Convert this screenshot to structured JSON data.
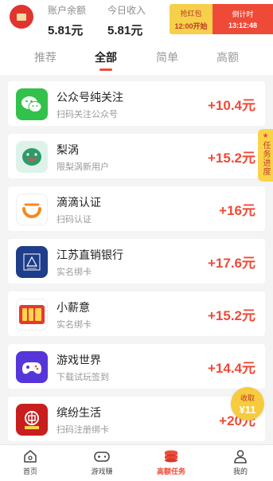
{
  "header": {
    "balance_label": "账户余额",
    "balance_value": "5.81元",
    "today_label": "今日收入",
    "today_value": "5.81元",
    "promo": {
      "grab_label": "抢红包",
      "start_time": "12:00开始",
      "countdown_label": "倒计时",
      "countdown_value": "13:12:48"
    }
  },
  "tabs": [
    {
      "label": "推荐",
      "active": false
    },
    {
      "label": "全部",
      "active": true
    },
    {
      "label": "简单",
      "active": false
    },
    {
      "label": "高额",
      "active": false
    }
  ],
  "tasks": [
    {
      "title": "公众号纯关注",
      "subtitle": "扫码关注公众号",
      "amount": "+10.4元",
      "icon": "wechat-icon"
    },
    {
      "title": "梨涡",
      "subtitle": "限梨涡新用户",
      "amount": "+15.2元",
      "icon": "lianwo-icon"
    },
    {
      "title": "滴滴认证",
      "subtitle": "扫码认证",
      "amount": "+16元",
      "icon": "didi-icon"
    },
    {
      "title": "江苏直销银行",
      "subtitle": "实名绑卡",
      "amount": "+17.6元",
      "icon": "jiangsu-bank-icon"
    },
    {
      "title": "小薪意",
      "subtitle": "实名绑卡",
      "amount": "+15.2元",
      "icon": "xiaoxinyi-icon"
    },
    {
      "title": "游戏世界",
      "subtitle": "下载试玩签到",
      "amount": "+14.4元",
      "icon": "game-world-icon"
    },
    {
      "title": "缤纷生活",
      "subtitle": "扫码注册绑卡",
      "amount": "+20元",
      "icon": "bank-of-china-icon"
    }
  ],
  "side_tab": {
    "label": "任务进度"
  },
  "coin": {
    "label": "收取",
    "value": "¥11"
  },
  "nav": [
    {
      "label": "首页",
      "icon": "home-icon",
      "active": false
    },
    {
      "label": "游戏赚",
      "icon": "gamepad-icon",
      "active": false
    },
    {
      "label": "高额任务",
      "icon": "coin-stack-icon",
      "active": true
    },
    {
      "label": "我的",
      "icon": "user-icon",
      "active": false
    }
  ],
  "colors": {
    "accent": "#ef4a37",
    "promo_yellow": "#f6d04a"
  }
}
